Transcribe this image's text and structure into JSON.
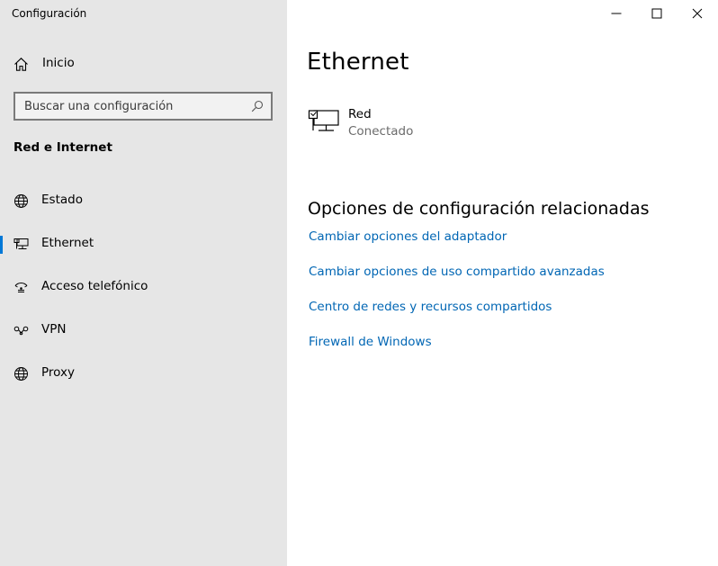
{
  "window": {
    "title": "Configuración"
  },
  "sidebar": {
    "home": {
      "label": "Inicio",
      "icon": "home-icon"
    },
    "search": {
      "placeholder": "Buscar una configuración",
      "value": "",
      "icon": "search-icon"
    },
    "section_heading": "Red e Internet",
    "items": [
      {
        "label": "Estado",
        "icon": "globe-icon",
        "selected": false
      },
      {
        "label": "Ethernet",
        "icon": "ethernet-icon",
        "selected": true
      },
      {
        "label": "Acceso telefónico",
        "icon": "dialup-icon",
        "selected": false
      },
      {
        "label": "VPN",
        "icon": "vpn-icon",
        "selected": false
      },
      {
        "label": "Proxy",
        "icon": "globe-icon",
        "selected": false
      }
    ]
  },
  "main": {
    "title": "Ethernet",
    "network": {
      "name": "Red",
      "status": "Conectado",
      "icon": "ethernet-network-icon"
    },
    "related": {
      "heading": "Opciones de configuración relacionadas",
      "links": [
        "Cambiar opciones del adaptador",
        "Cambiar opciones de uso compartido avanzadas",
        "Centro de redes y recursos compartidos",
        "Firewall de Windows"
      ]
    }
  },
  "colors": {
    "sidebar_bg": "#e6e6e6",
    "accent": "#0078d7",
    "link": "#0066b4",
    "secondary_text": "#6b6b6b"
  }
}
